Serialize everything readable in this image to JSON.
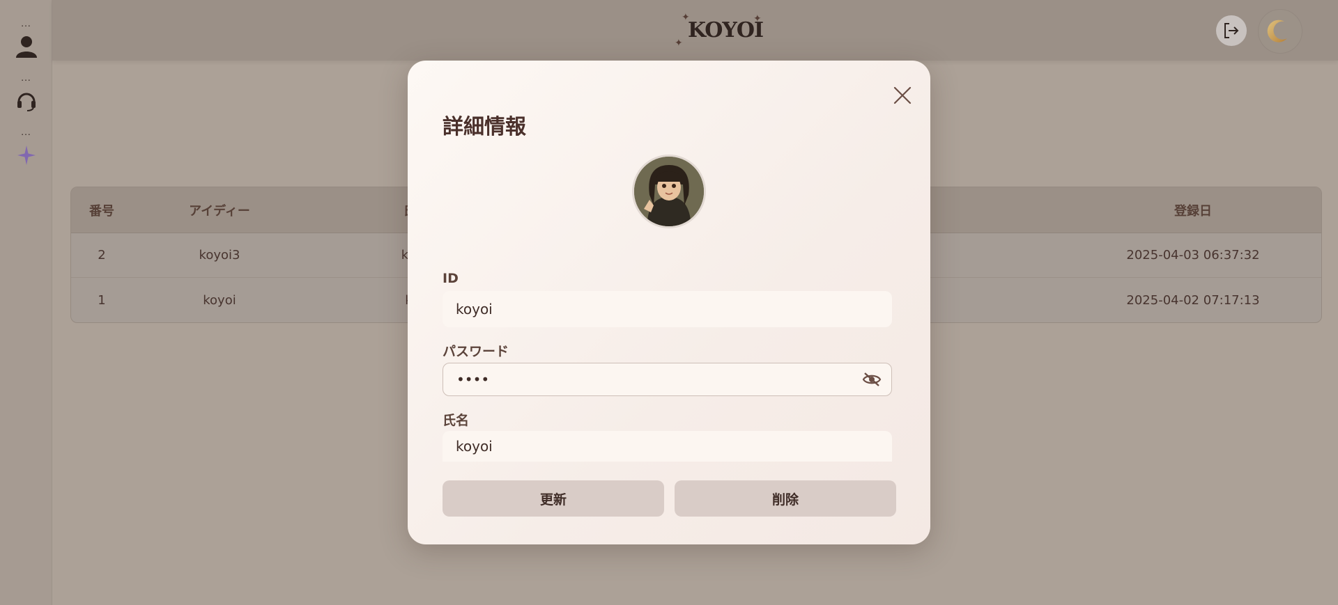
{
  "sidebar": {
    "items": [
      {
        "dots": "...",
        "icon": "user-icon"
      },
      {
        "dots": "...",
        "icon": "headset-icon"
      },
      {
        "dots": "...",
        "icon": "sparkle-icon"
      }
    ]
  },
  "header": {
    "logo": "KOYOI",
    "logout_icon": "logout-icon",
    "theme_icon": "moon-icon"
  },
  "table": {
    "columns": [
      "番号",
      "アイディー",
      "氏名",
      "登録日"
    ],
    "rows": [
      {
        "no": "2",
        "id": "koyoi3",
        "name": "koyo",
        "date": "2025-04-03  06:37:32"
      },
      {
        "no": "1",
        "id": "koyoi",
        "name": "koy",
        "date": "2025-04-02  07:17:13"
      }
    ]
  },
  "modal": {
    "title": "詳細情報",
    "fields": {
      "id_label": "ID",
      "id_value": "koyoi",
      "password_label": "パスワード",
      "password_value": "••••",
      "name_label": "氏名",
      "name_value": "koyoi"
    },
    "buttons": {
      "update": "更新",
      "delete": "削除"
    }
  },
  "colors": {
    "accent": "#8a6fc0",
    "brand": "#2f2320"
  }
}
